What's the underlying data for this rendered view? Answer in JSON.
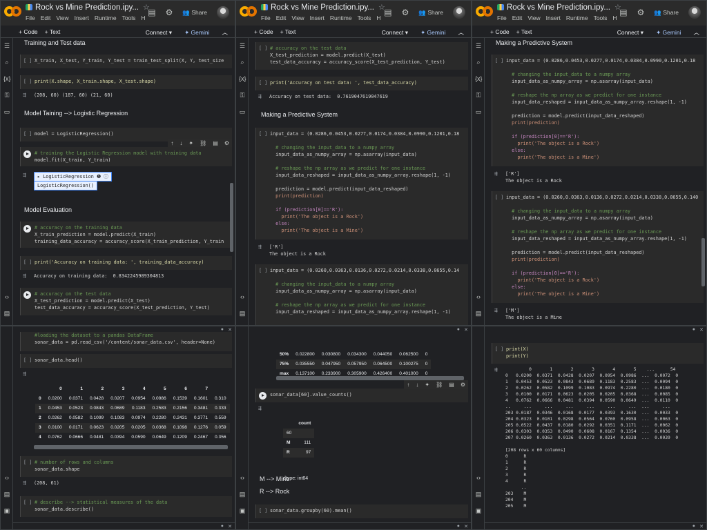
{
  "window": {
    "title": "Rock vs Mine Prediction.ipy...",
    "menu": [
      "File",
      "Edit",
      "View",
      "Insert",
      "Runtime",
      "Tools",
      "H"
    ],
    "share": "Share",
    "add_code": "+ Code",
    "add_text": "+ Text",
    "connect": "Connect",
    "gemini": "Gemini"
  },
  "colors": {
    "keyword": "#c586c0",
    "string": "#ce9178",
    "comment": "#6a9955",
    "func": "#dcdcaa",
    "accent": "#f9ab00"
  },
  "pane1": {
    "h_train": "Training and Test data",
    "c1": "X_train, X_test, Y_train, Y_test = train_test_split(X, Y, test_size",
    "c2": "print(X.shape, X_train.shape, X_test.shape)",
    "o2": "(208, 60) (187, 60) (21, 60)",
    "h_model": "Model Taining --> Logistic Regression",
    "c3": "model = LogisticRegression()",
    "c4a": "# training the Logistic Regression model with training data",
    "c4b": "model.fit(X_train, Y_train)",
    "o4a": "LogisticRegression",
    "o4b": "LogisticRegression()",
    "h_eval": "Model Evaluation",
    "c5a": "# accuracy on the training data",
    "c5b": "X_train_prediction = model.predict(X_train)",
    "c5c": "training_data_accuracy = accuracy_score(X_train_prediction, Y_train",
    "c6": "print('Accuracy on training data: ', training_data_accuracy)",
    "o6": "Accuracy on training data:  0.8342245989304813",
    "c7a": "# accuracy on the test data",
    "c7b": "X_test_prediction = model.predict(X_test)",
    "c7c": "test_data_accuracy = accuracy_score(X_test_prediction, Y_test)"
  },
  "pane2": {
    "c1a": "# accuracy on the test data",
    "c1b": "X_test_prediction = model.predict(X_test)",
    "c1c": "test_data_accuracy = accuracy_score(X_test_prediction, Y_test)",
    "c2": "print('Accuracy on test data: ', test_data_accuracy)",
    "o2": "Accuracy on test data:  0.7619047619047619",
    "h_pred": "Making a Predictive System",
    "c3": [
      "input_data = (0.0286,0.0453,0.0277,0.0174,0.0384,0.0990,0.1201,0.18",
      "",
      "  # changing the input_data to a numpy array",
      "  input_data_as_numpy_array = np.asarray(input_data)",
      "",
      "  # reshape the np array as we predict for one instance",
      "  input_data_reshaped = input_data_as_numpy_array.reshape(1, -1)",
      "",
      "  prediction = model.predict(input_data_reshaped)",
      "  print(prediction)",
      "",
      "  if (prediction[0]=='R'):",
      "    print('The object is a Rock')",
      "  else:",
      "    print('The object is a Mine')"
    ],
    "o3": [
      "['R']",
      "The object is a Rock"
    ],
    "c4": [
      "input_data = (0.0260,0.0363,0.0136,0.0272,0.0214,0.0338,0.0655,0.14",
      "",
      "  # changing the input_data to a numpy array",
      "  input_data_as_numpy_array = np.asarray(input_data)",
      "",
      "  # reshape the np array as we predict for one instance",
      "  input_data_reshaped = input_data_as_numpy_array.reshape(1, -1)"
    ]
  },
  "pane3": {
    "h_pred": "Making a Predictive System",
    "c1": [
      "input_data = (0.0286,0.0453,0.0277,0.0174,0.0384,0.0990,0.1201,0.18",
      "",
      "  # changing the input_data to a numpy array",
      "  input_data_as_numpy_array = np.asarray(input_data)",
      "",
      "  # reshape the np array as we predict for one instance",
      "  input_data_reshaped = input_data_as_numpy_array.reshape(1, -1)",
      "",
      "  prediction = model.predict(input_data_reshaped)",
      "  print(prediction)",
      "",
      "  if (prediction[0]=='R'):",
      "    print('The object is a Rock')",
      "  else:",
      "    print('The object is a Mine')"
    ],
    "o1": [
      "['R']",
      "The object is a Rock"
    ],
    "c2": [
      "input_data = (0.0260,0.0363,0.0136,0.0272,0.0214,0.0338,0.0655,0.140",
      "",
      "  # changing the input_data to a numpy array",
      "  input_data_as_numpy_array = np.asarray(input_data)",
      "",
      "  # reshape the np array as we predict for one instance",
      "  input_data_reshaped = input_data_as_numpy_array.reshape(1, -1)",
      "",
      "  prediction = model.predict(input_data_reshaped)",
      "  print(prediction)",
      "",
      "  if (prediction[0]=='R'):",
      "    print('The object is a Rock')",
      "  else:",
      "    print('The object is a Mine')"
    ],
    "o2": [
      "['M']",
      "The object is a Mine"
    ]
  },
  "pane4": {
    "c0a": "#loading the dataset to a pandas DataFrame",
    "c0b": "sonar_data = pd.read_csv('/content/sonar_data.csv', header=None)",
    "c1": "sonar_data.head()",
    "head_cols": [
      "0",
      "1",
      "2",
      "3",
      "4",
      "5",
      "6",
      "7"
    ],
    "head_rows": [
      [
        "0",
        "0.0200",
        "0.0371",
        "0.0428",
        "0.0207",
        "0.0954",
        "0.0986",
        "0.1539",
        "0.1601",
        "0.310"
      ],
      [
        "1",
        "0.0453",
        "0.0523",
        "0.0843",
        "0.0689",
        "0.1183",
        "0.2583",
        "0.2156",
        "0.3481",
        "0.333"
      ],
      [
        "2",
        "0.0262",
        "0.0582",
        "0.1099",
        "0.1083",
        "0.0974",
        "0.2280",
        "0.2431",
        "0.3771",
        "0.559"
      ],
      [
        "3",
        "0.0100",
        "0.0171",
        "0.0623",
        "0.0205",
        "0.0205",
        "0.0368",
        "0.1098",
        "0.1276",
        "0.059"
      ],
      [
        "4",
        "0.0762",
        "0.0666",
        "0.0481",
        "0.0394",
        "0.0590",
        "0.0649",
        "0.1209",
        "0.2467",
        "0.356"
      ]
    ],
    "c2a": "# number of rows and columns",
    "c2b": "sonar_data.shape",
    "o2": "(208, 61)",
    "c3a": "# describe --> statistical measures of the data",
    "c3b": "sonar_data.describe()"
  },
  "pane5": {
    "desc_rows": [
      [
        "50%",
        "0.022800",
        "0.030800",
        "0.034300",
        "0.044050",
        "0.062500",
        "0"
      ],
      [
        "75%",
        "0.035550",
        "0.047950",
        "0.057950",
        "0.064500",
        "0.100275",
        "0"
      ],
      [
        "max",
        "0.137100",
        "0.233900",
        "0.305900",
        "0.426400",
        "0.401000",
        "0"
      ]
    ],
    "c1": "sonar_data[60].value_counts()",
    "vc_header": "count",
    "vc_index": "60",
    "vc_rows": [
      [
        "M",
        "111"
      ],
      [
        "R",
        "97"
      ]
    ],
    "vc_dtype": "dtype: int64",
    "md1": "M --> Mine",
    "md2": "R --> Rock",
    "c2": "sonar_data.groupby(60).mean()"
  },
  "pane6": {
    "c1a": "print(X)",
    "c1b": "print(Y)",
    "o1": [
      "         0       1       2       3       4       5    ...      54",
      "0   0.0200  0.0371  0.0428  0.0207  0.0954  0.0986  ...  0.0072  0",
      "1   0.0453  0.0523  0.0843  0.0689  0.1183  0.2583  ...  0.0094  0",
      "2   0.0262  0.0582  0.1099  0.1083  0.0974  0.2280  ...  0.0180  0",
      "3   0.0100  0.0171  0.0623  0.0205  0.0205  0.0368  ...  0.0085  0",
      "4   0.0762  0.0666  0.0481  0.0394  0.0590  0.0649  ...  0.0110  0",
      "..     ...     ...     ...     ...     ...     ...  ...     ...",
      "203 0.0187  0.0346  0.0168  0.0177  0.0393  0.1630  ...  0.0033  0",
      "204 0.0323  0.0101  0.0298  0.0564  0.0760  0.0958  ...  0.0063  0",
      "205 0.0522  0.0437  0.0180  0.0292  0.0351  0.1171  ...  0.0062  0",
      "206 0.0303  0.0353  0.0490  0.0608  0.0167  0.1354  ...  0.0036  0",
      "207 0.0260  0.0363  0.0136  0.0272  0.0214  0.0338  ...  0.0039  0",
      "",
      "[208 rows x 60 columns]",
      "0      R",
      "1      R",
      "2      R",
      "3      R",
      "4      R",
      "      ..",
      "203    M",
      "204    M",
      "205    M"
    ]
  }
}
